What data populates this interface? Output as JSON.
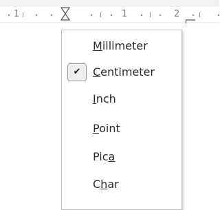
{
  "ruler": {
    "numbers": [
      "1",
      "1",
      "2"
    ]
  },
  "menu": {
    "items": [
      {
        "pre": "",
        "mnemonic": "M",
        "post": "illimeter",
        "checked": false
      },
      {
        "pre": "",
        "mnemonic": "C",
        "post": "entimeter",
        "checked": true
      },
      {
        "pre": "",
        "mnemonic": "I",
        "post": "nch",
        "checked": false
      },
      {
        "pre": "",
        "mnemonic": "P",
        "post": "oint",
        "checked": false
      },
      {
        "pre": "Pic",
        "mnemonic": "a",
        "post": "",
        "checked": false
      },
      {
        "pre": "C",
        "mnemonic": "h",
        "post": "ar",
        "checked": false
      }
    ],
    "check_glyph": "✔"
  }
}
